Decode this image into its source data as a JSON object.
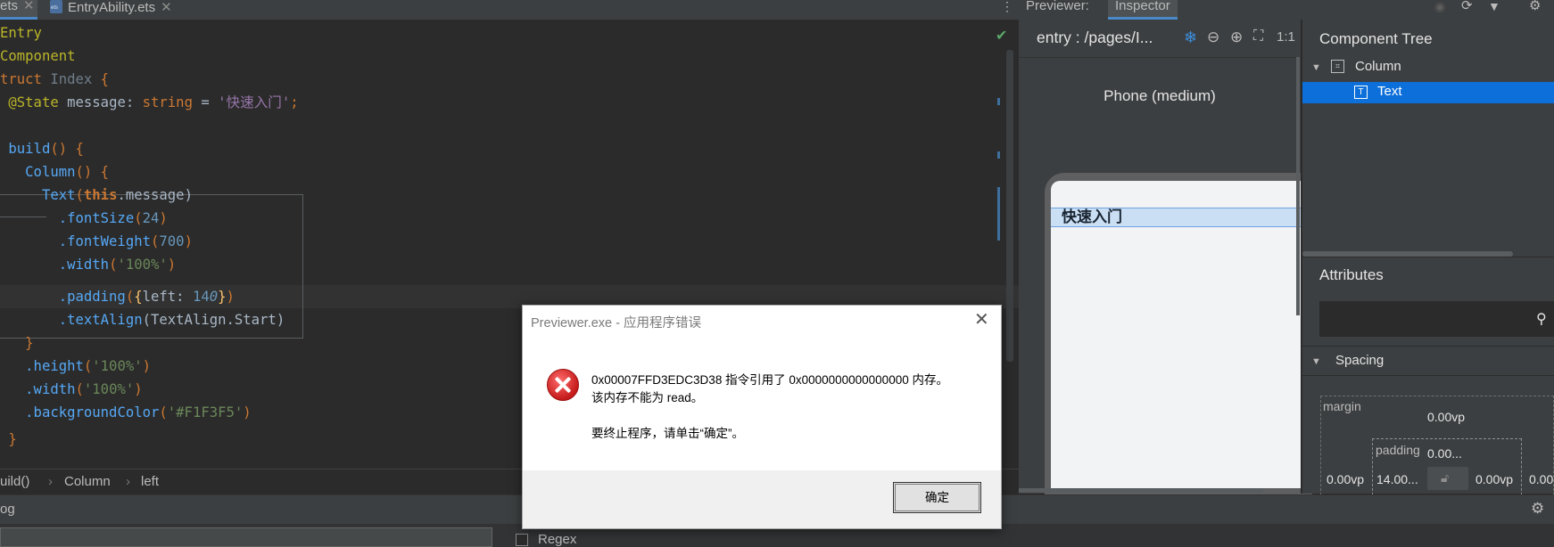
{
  "editor": {
    "tabs": [
      {
        "label": "ets",
        "close": "✕"
      },
      {
        "label": "EntryAbility.ets",
        "close": "✕"
      }
    ],
    "lines": {
      "l1": "Entry",
      "l2": "Component",
      "l3a": "truct ",
      "l3b": "Index",
      "l3c": " {",
      "l4a": "@State",
      "l4b": " message: ",
      "l4c": "string",
      "l4d": " = ",
      "l4e": "'快速入门'",
      "l4f": ";",
      "l6a": "build",
      "l6b": "() {",
      "l7a": "Column",
      "l7b": "() {",
      "l8a": "Text",
      "l8b": "(",
      "l8c": "this",
      "l8d": ".message)",
      "l9a": ".fontSize",
      "l9b": "(",
      "l9c": "24",
      "l9d": ")",
      "l10a": ".fontWeight",
      "l10b": "(",
      "l10c": "700",
      "l10d": ")",
      "l11a": ".width",
      "l11b": "(",
      "l11c": "'100%'",
      "l11d": ")",
      "l12a": ".padding",
      "l12b": "(",
      "l12c": "{",
      "l12d": "left: ",
      "l12e": "14",
      "l12f": "0",
      "l12g": "}",
      "l12h": ")",
      "l13a": ".textAlign",
      "l13b": "(TextAlign.Start)",
      "l14": "}",
      "l15a": ".height",
      "l15b": "(",
      "l15c": "'100%'",
      "l15d": ")",
      "l16a": ".width",
      "l16b": "(",
      "l16c": "'100%'",
      "l16d": ")",
      "l17a": ".backgroundColor",
      "l17b": "(",
      "l17c": "'#F1F3F5'",
      "l17d": ")",
      "l18": "}"
    },
    "breadcrumb": [
      "uild()",
      "Column",
      "left"
    ],
    "breadcrumb_sep": "›"
  },
  "bottom": {
    "log_label": "og",
    "regex_label": "Regex"
  },
  "previewer": {
    "tabs": [
      "Previewer:",
      "Inspector"
    ],
    "path": "entry : /pages/I...",
    "ratio_label": "1:1",
    "device": "Phone (medium)",
    "screen_text": "快速入门"
  },
  "component_tree": {
    "title": "Component Tree",
    "items": [
      "Column",
      "Text"
    ]
  },
  "attributes": {
    "title": "Attributes",
    "section": "Spacing",
    "margin_label": "margin",
    "margin_top": "0.00vp",
    "margin_left": "0.00vp",
    "padding_label": "padding",
    "padding_top": "0.00...",
    "padding_left": "14.00...",
    "padding_right": "0.00vp",
    "margin_right": "0.00"
  },
  "dialog": {
    "title": "Previewer.exe - 应用程序错误",
    "line1": "0x00007FFD3EDC3D38 指令引用了 0x0000000000000000 内存。",
    "line2": "该内存不能为 read。",
    "line3": "要终止程序，请单击“确定”。",
    "ok_label": "确定",
    "close": "✕"
  },
  "colors": {
    "editor_bg": "#2b2b2b",
    "panel_bg": "#3c3f41",
    "selection": "#0d6fd9",
    "keyword": "#cc7832",
    "string": "#6a8759",
    "number": "#6897bb"
  }
}
